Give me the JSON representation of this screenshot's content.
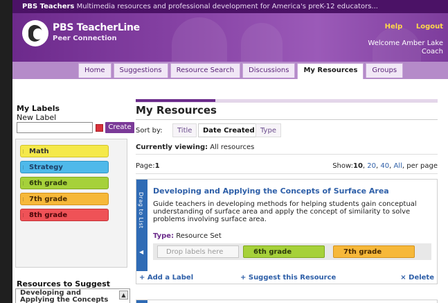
{
  "topbar": {
    "brand": "PBS Teachers",
    "tagline": "Multimedia resources and professional development for America's preK-12 educators..."
  },
  "header": {
    "brand_name": "PBS TeacherLine",
    "brand_sub": "Peer Connection",
    "help": "Help",
    "logout": "Logout",
    "welcome_line1": "Welcome  Amber Lake",
    "welcome_line2": "Coach"
  },
  "nav": {
    "tabs": [
      {
        "label": "Home",
        "active": false
      },
      {
        "label": "Suggestions",
        "active": false
      },
      {
        "label": "Resource Search",
        "active": false
      },
      {
        "label": "Discussions",
        "active": false
      },
      {
        "label": "My Resources",
        "active": true
      },
      {
        "label": "Groups",
        "active": false
      }
    ]
  },
  "sidebar": {
    "my_labels_title": "My Labels",
    "new_label_text": "New Label",
    "new_label_value": "",
    "create_button": "Create",
    "swatch_color": "#d9323b",
    "labels": [
      {
        "name": "Math",
        "color": "#f5e94a",
        "border": "#d2c32a"
      },
      {
        "name": "Strategy",
        "color": "#4fb9ea",
        "border": "#2d93c4"
      },
      {
        "name": "6th grade",
        "color": "#a6d13a",
        "border": "#7fa71f"
      },
      {
        "name": "7th grade",
        "color": "#f6b83a",
        "border": "#d4921c"
      },
      {
        "name": "8th grade",
        "color": "#ef5257",
        "border": "#c52f34"
      }
    ],
    "resources_to_suggest_title": "Resources to Suggest",
    "suggest_list_line1": "Developing and",
    "suggest_list_line2": "Applying the Concepts"
  },
  "main": {
    "title": "My Resources",
    "sort_by": "Sort by:",
    "sort_options": [
      {
        "label": "Title",
        "active": false
      },
      {
        "label": "Date Created",
        "active": true
      },
      {
        "label": "Type",
        "active": false
      }
    ],
    "viewing_label": "Currently viewing:",
    "viewing_value": "All resources",
    "page_label": "Page:",
    "page_value": "1",
    "show_label": "Show:",
    "show_current": "10",
    "show_options": [
      "20",
      "40",
      "All"
    ],
    "per_page": "per page"
  },
  "card": {
    "drag_text": "Drag to List",
    "title": "Developing and Applying the Concepts of Surface Area",
    "description": "Guide teachers in developing methods for helping students gain conceptual understanding of surface area and apply the concept of similarity to solve problems involving surface area.",
    "type_label": "Type:",
    "type_value": "Resource Set",
    "drop_placeholder": "Drop labels here",
    "labels": [
      {
        "name": "6th grade",
        "color": "#a6d13a",
        "border": "#7fa71f"
      },
      {
        "name": "7th grade",
        "color": "#f6b83a",
        "border": "#d4921c"
      }
    ],
    "add_label": "+ Add a Label",
    "suggest": "+ Suggest this Resource",
    "delete": "× Delete"
  }
}
